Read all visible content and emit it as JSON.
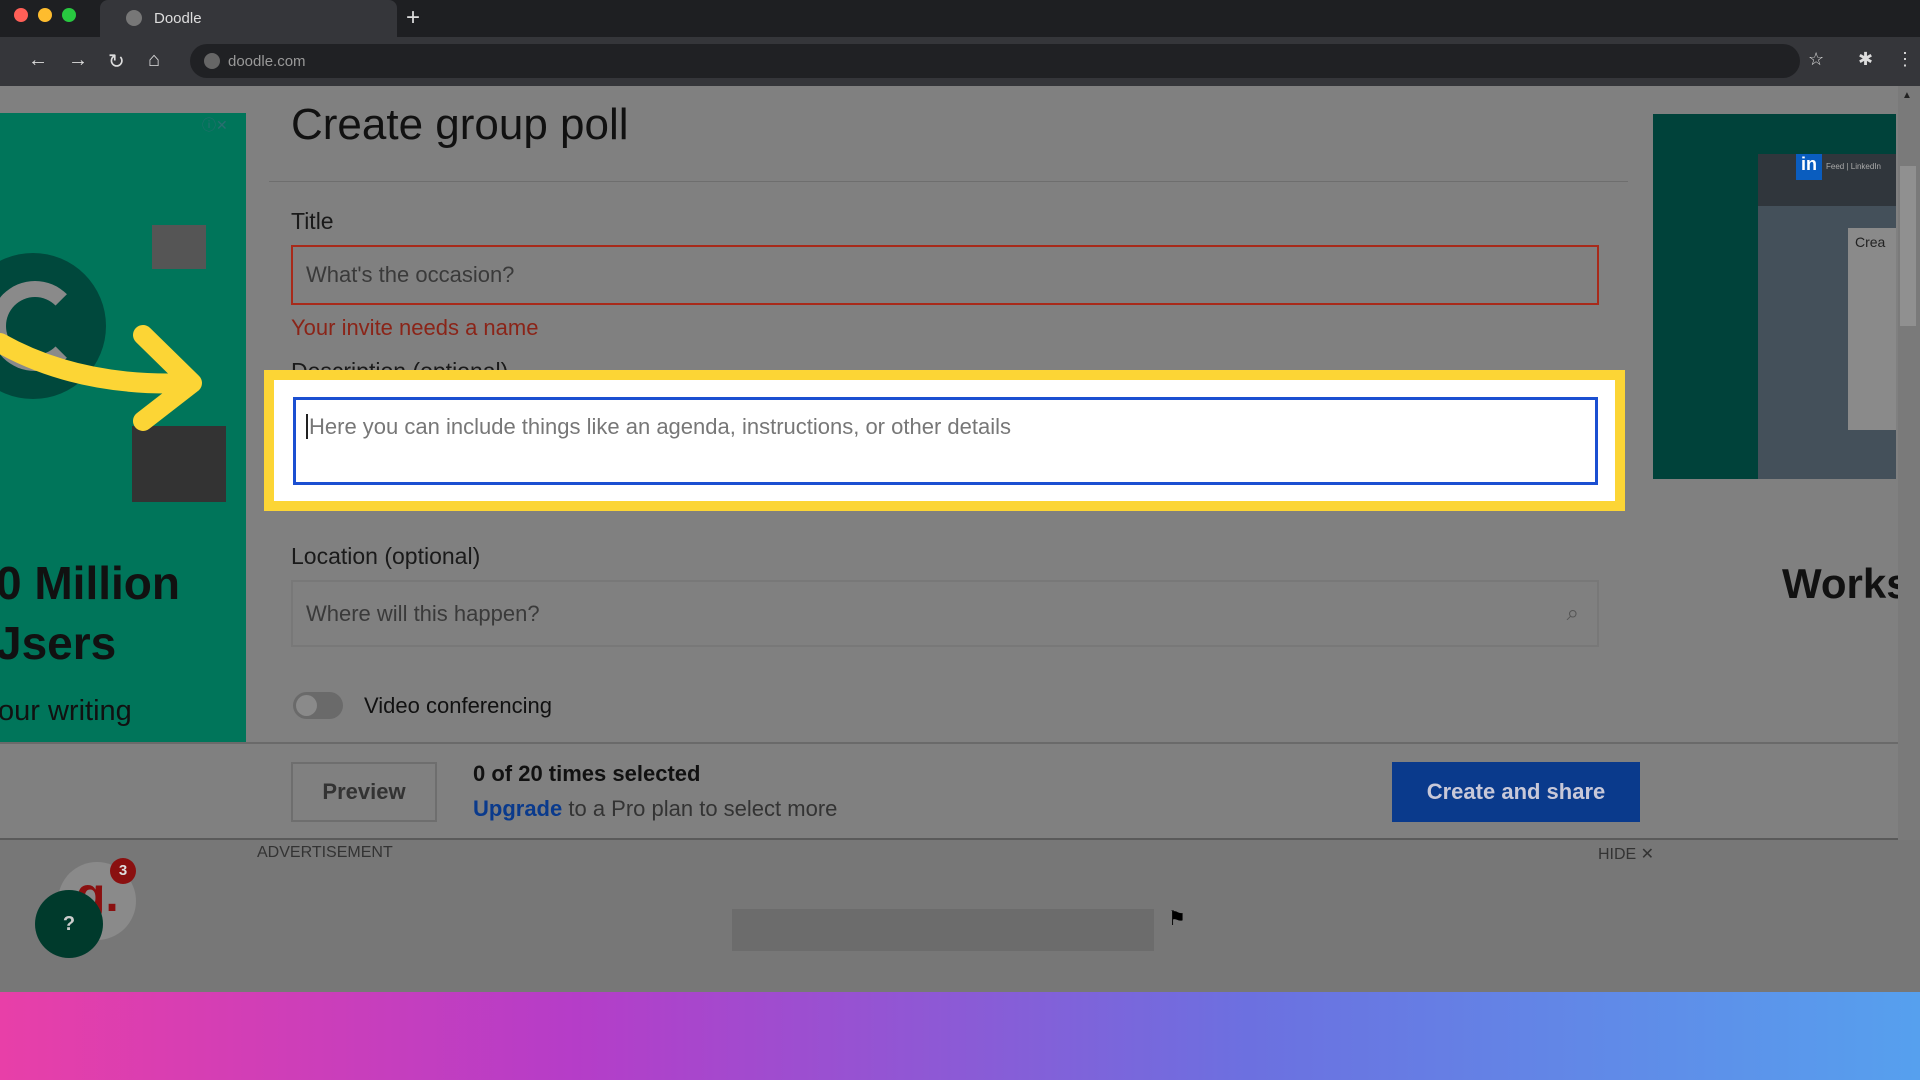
{
  "browser": {
    "tab_title": "Doodle",
    "url": "doodle.com",
    "new_tab": "+"
  },
  "page": {
    "title": "Create group poll"
  },
  "form": {
    "title_label": "Title",
    "title_placeholder": "What's the occasion?",
    "title_error": "Your invite needs a name",
    "description_label": "Description (optional)",
    "description_placeholder": "Here you can include things like an agenda, instructions, or other details",
    "location_label": "Location (optional)",
    "location_placeholder": "Where will this happen?",
    "video_label": "Video conferencing",
    "video_enabled": false
  },
  "footer": {
    "preview": "Preview",
    "selected": "0 of 20 times selected",
    "upgrade": "Upgrade",
    "upgrade_rest": " to a Pro plan to select more",
    "create": "Create and share"
  },
  "ads": {
    "label": "ADVERTISEMENT",
    "hide": "HIDE ✕",
    "left_line1": "0 Million",
    "left_line2": "Jsers",
    "left_line3": "our writing",
    "right_text": "Works",
    "right_inner_title": "Feed | LinkedIn",
    "right_inner_create": "Crea"
  },
  "help": {
    "badge": "3",
    "label": "?"
  },
  "colors": {
    "accent": "#0a3a8c",
    "error": "#a82a1a",
    "highlight": "#fcd535",
    "focus": "#1b4fd1"
  }
}
